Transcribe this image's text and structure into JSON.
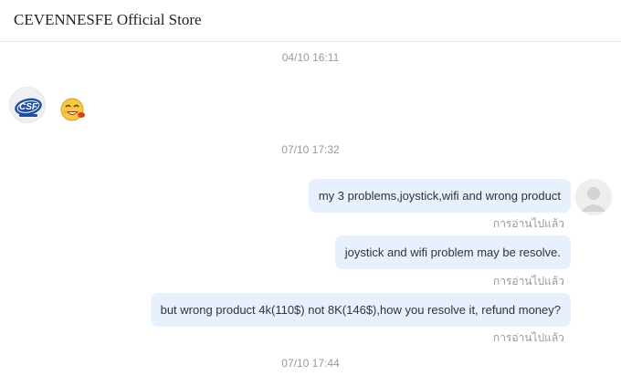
{
  "header": {
    "store_name": "CEVENNESFE Official Store"
  },
  "timestamps": [
    "04/10 16:11",
    "07/10 17:32",
    "07/10 17:44"
  ],
  "seller": {
    "avatar_icon": "csf-logo-icon",
    "avatar_text": "CSF",
    "sticker_icon": "laughing-emoji-icon"
  },
  "messages": [
    {
      "text": "my 3 problems,joystick,wifi and wrong product",
      "status": "การอ่านไปแล้ว"
    },
    {
      "text": "joystick and wifi problem may be resolve.",
      "status": "การอ่านไปแล้ว"
    },
    {
      "text": "but wrong product 4k(110$) not 8K(146$),how you resolve it, refund money?",
      "status": "การอ่านไปแล้ว"
    }
  ],
  "user": {
    "avatar_icon": "default-user-avatar-icon"
  },
  "colors": {
    "bubble": "#e6f1fd",
    "timestamp": "#999999",
    "divider": "#e5e5e5"
  }
}
